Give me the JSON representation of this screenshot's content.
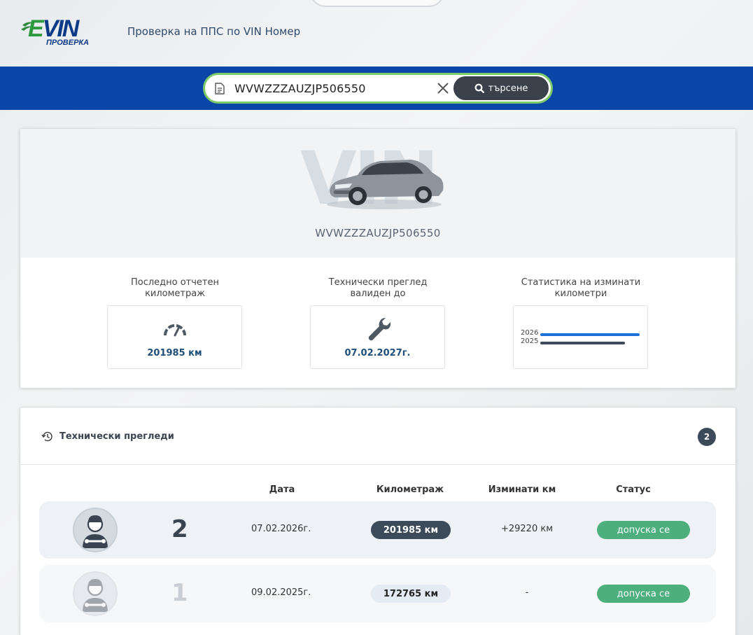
{
  "header": {
    "logo_text": "EVIN",
    "logo_subtext": "ПРОВЕРКА",
    "tagline": "Проверка на ППС по VIN Номер"
  },
  "search": {
    "value": "WVWZZZAUZJP506550",
    "button_label": "търсене"
  },
  "vehicle": {
    "watermark": "VIN",
    "vin": "WVWZZZAUZJP506550"
  },
  "stats": {
    "mileage_label": "Последно отчетен километраж",
    "mileage_value": "201985 км",
    "inspection_label": "Технически преглед валиден до",
    "inspection_value": "07.02.2027г.",
    "chart_label": "Статистика на изминати километри",
    "chart_data": {
      "type": "bar",
      "categories": [
        "2026",
        "2025"
      ],
      "series": [
        {
          "values": [
            201985,
            172765
          ]
        }
      ],
      "colors": [
        "#1e6fd9",
        "#3d4a5a"
      ]
    }
  },
  "inspections": {
    "title": "Технически прегледи",
    "count": "2",
    "columns": [
      "Дата",
      "Километраж",
      "Изминати км",
      "Статус"
    ],
    "rows": [
      {
        "num": "2",
        "date": "07.02.2026г.",
        "km": "201985 км",
        "diff": "+29220 км",
        "status": "допуска се"
      },
      {
        "num": "1",
        "date": "09.02.2025г.",
        "km": "172765 км",
        "diff": "-",
        "status": "допуска се"
      }
    ]
  },
  "colors": {
    "brand_blue": "#0a45a8",
    "search_border": "#7ecb6a",
    "status_green": "#4caf7d",
    "dark_pill": "#3d4a5a"
  }
}
